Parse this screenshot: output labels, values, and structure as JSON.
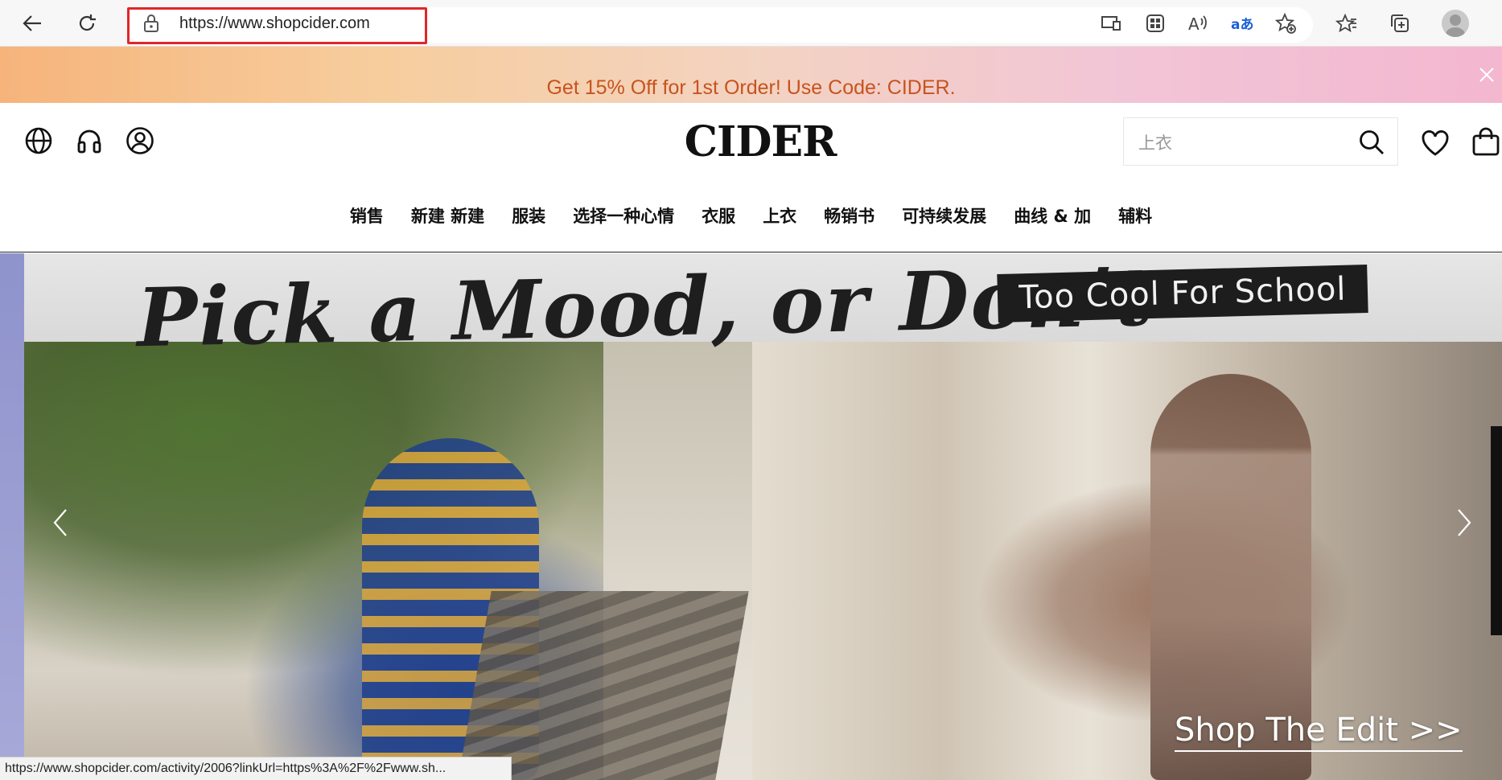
{
  "browser": {
    "url": "https://www.shopcider.com",
    "icons": [
      "back-arrow-icon",
      "refresh-icon",
      "lock-icon",
      "app-available-icon",
      "tab-actions-icon",
      "read-aloud-icon",
      "translate-icon",
      "add-favorite-icon",
      "favorites-icon",
      "collections-icon",
      "profile-avatar-icon"
    ]
  },
  "promo": {
    "text": "Get 15% Off for 1st Order! Use Code: CIDER."
  },
  "header": {
    "logo": "CIDER",
    "search_value": "上衣"
  },
  "nav": {
    "items": [
      {
        "label": "销售"
      },
      {
        "label": "新建 新建"
      },
      {
        "label": "服装"
      },
      {
        "label": "选择一种心情"
      },
      {
        "label": "衣服"
      },
      {
        "label": "上衣"
      },
      {
        "label": "畅销书"
      },
      {
        "label": "可持续发展"
      },
      {
        "label": "曲线 & 加"
      },
      {
        "label": "辅料"
      }
    ]
  },
  "hero": {
    "title": "Pick a Mood, or Don’t",
    "tag": "Too Cool For School",
    "cta": "Shop The Edit >>"
  },
  "statusbar": {
    "text": "https://www.shopcider.com/activity/2006?linkUrl=https%3A%2F%2Fwww.sh..."
  }
}
